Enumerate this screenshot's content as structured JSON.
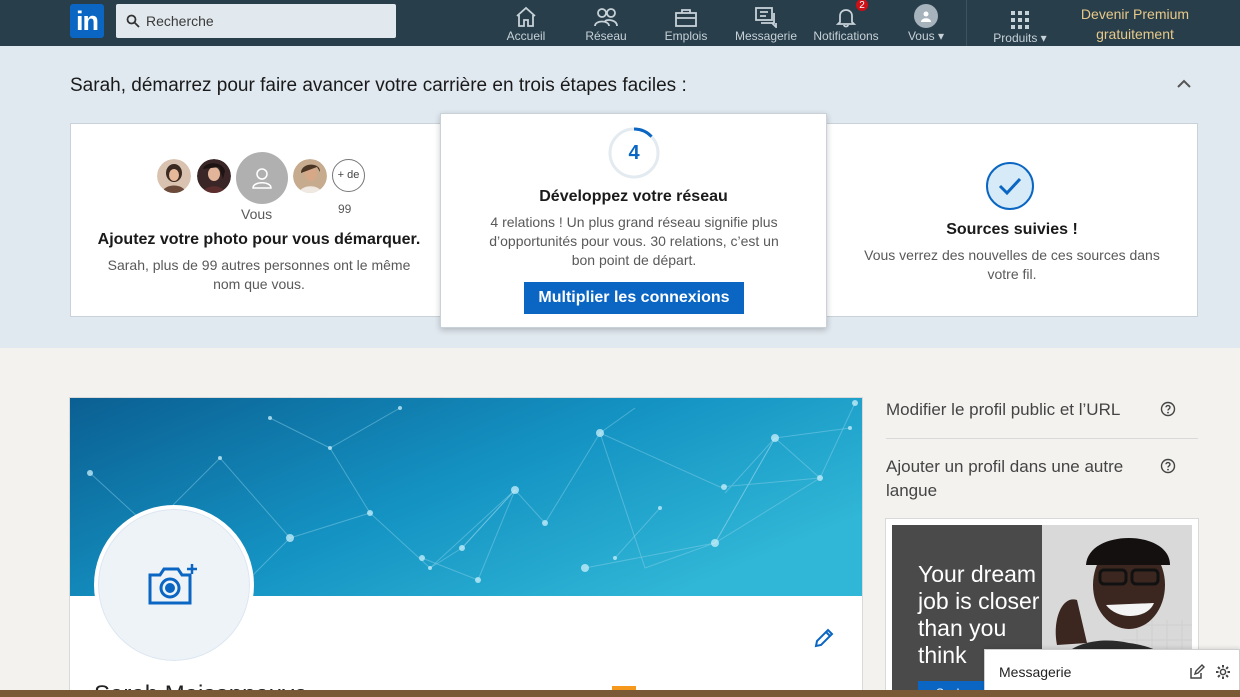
{
  "nav": {
    "search_placeholder": "Recherche",
    "items": [
      {
        "label": "Accueil",
        "icon": "home-icon"
      },
      {
        "label": "Réseau",
        "icon": "network-icon"
      },
      {
        "label": "Emplois",
        "icon": "briefcase-icon"
      },
      {
        "label": "Messagerie",
        "icon": "messaging-icon"
      },
      {
        "label": "Notifications",
        "icon": "bell-icon",
        "badge": "2"
      },
      {
        "label": "Vous",
        "icon": "avatar-icon"
      }
    ],
    "products_label": "Produits",
    "premium_line1": "Devenir Premium",
    "premium_line2": "gratuitement",
    "colors": {
      "bar": "#283e4a",
      "premium": "#e7c98a",
      "badge": "#cc1016"
    }
  },
  "onboarding": {
    "title": "Sarah, démarrez pour faire avancer votre carrière en trois étapes faciles :",
    "step_photo": {
      "you_label": "Vous",
      "more_label": "+ de",
      "more_count": "99",
      "title": "Ajoutez votre photo pour vous démarquer.",
      "text": "Sarah, plus de 99 autres personnes ont le même nom que vous."
    },
    "step_network": {
      "progress_value": "4",
      "progress_fraction": 0.13,
      "title": "Développez votre réseau",
      "text": "4 relations ! Un plus grand réseau signifie plus d’opportunités pour vous. 30 relations, c’est un bon point de départ.",
      "cta": "Multiplier les connexions"
    },
    "step_sources": {
      "title": "Sources suivies !",
      "text": "Vous verrez des nouvelles de ces sources dans votre fil."
    }
  },
  "profile": {
    "name": "Sarah Maisonneuve"
  },
  "rail": {
    "link1": "Modifier le profil public et l’URL",
    "link2": "Ajouter un profil dans une autre langue",
    "ad_text": "Your dream job is closer than you think",
    "ad_button": "Sachez"
  },
  "messaging": {
    "label": "Messagerie"
  },
  "accent": "#0a66c2"
}
